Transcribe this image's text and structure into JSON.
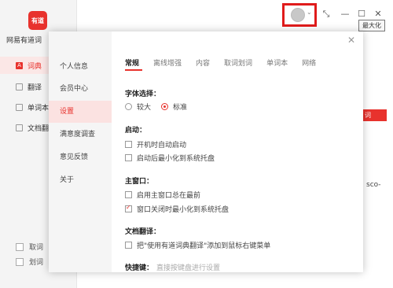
{
  "app": {
    "logo_text": "有道",
    "name": "网易有道词",
    "nav": [
      {
        "label": "词典",
        "active": true
      },
      {
        "label": "翻译",
        "active": false
      },
      {
        "label": "单词本",
        "active": false
      },
      {
        "label": "文档翻",
        "active": false
      }
    ],
    "footer_options": [
      {
        "label": "取词"
      },
      {
        "label": "划词"
      }
    ]
  },
  "titlebar": {
    "tooltip": "最大化",
    "background_button": "词",
    "background_text": "sco-"
  },
  "settings": {
    "nav": [
      {
        "label": "个人信息",
        "active": false
      },
      {
        "label": "会员中心",
        "active": false
      },
      {
        "label": "设置",
        "active": true
      },
      {
        "label": "满意度调查",
        "active": false
      },
      {
        "label": "意见反馈",
        "active": false
      },
      {
        "label": "关于",
        "active": false
      }
    ],
    "tabs": [
      {
        "label": "常规",
        "active": true
      },
      {
        "label": "离线增强",
        "active": false
      },
      {
        "label": "内容",
        "active": false
      },
      {
        "label": "取词划词",
        "active": false
      },
      {
        "label": "单词本",
        "active": false
      },
      {
        "label": "网络",
        "active": false
      }
    ],
    "font_section": {
      "title": "字体选择：",
      "options": [
        {
          "label": "较大",
          "checked": false
        },
        {
          "label": "标准",
          "checked": true
        }
      ]
    },
    "startup_section": {
      "title": "启动：",
      "options": [
        {
          "label": "开机时自动启动",
          "checked": false
        },
        {
          "label": "启动后最小化到系统托盘",
          "checked": false
        }
      ]
    },
    "main_window_section": {
      "title": "主窗口：",
      "options": [
        {
          "label": "启用主窗口总在最前",
          "checked": false
        },
        {
          "label": "窗口关闭时最小化到系统托盘",
          "checked": true
        }
      ]
    },
    "doc_translate_section": {
      "title": "文档翻译：",
      "options": [
        {
          "label": "把\"使用有道词典翻译\"添加到鼠标右键菜单",
          "checked": false
        }
      ]
    },
    "shortcut_section": {
      "title": "快捷键：",
      "hint": "直接按键盘进行设置"
    }
  }
}
